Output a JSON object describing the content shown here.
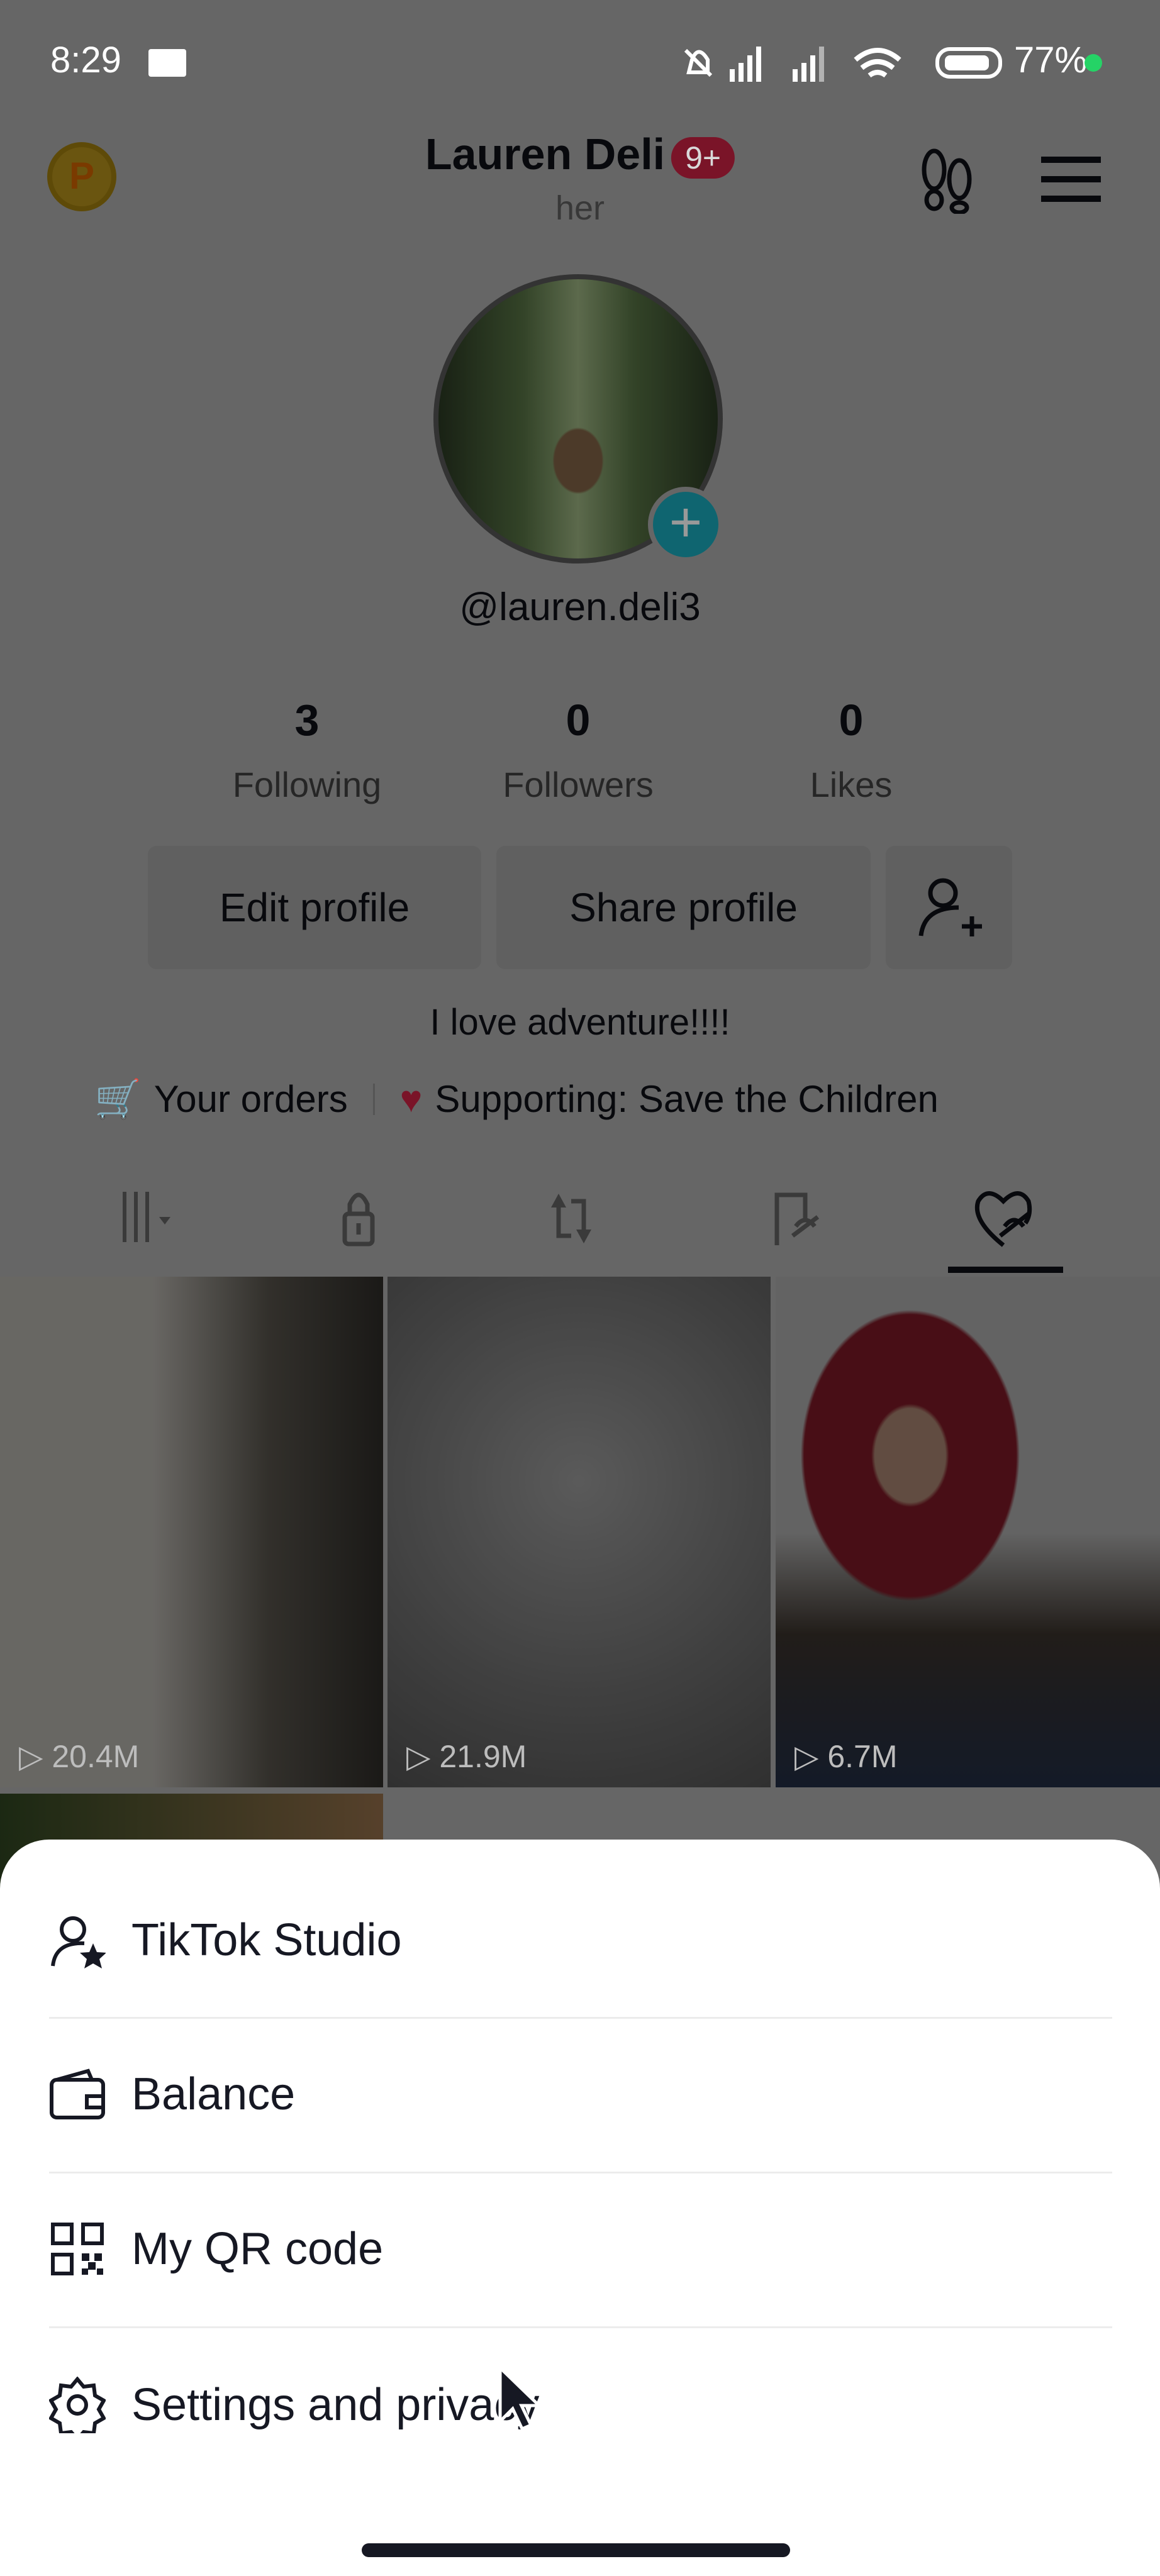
{
  "status_bar": {
    "time": "8:29",
    "battery": "77%",
    "icons": [
      "video-camera-icon",
      "mute-icon",
      "signal-icon",
      "signal-icon",
      "wifi-icon",
      "battery-icon"
    ]
  },
  "header": {
    "coin_label": "P",
    "display_name": "Lauren Deli",
    "notification_badge": "9+",
    "pronouns": "her",
    "icons": [
      "footprints-icon",
      "menu-icon"
    ]
  },
  "profile": {
    "handle": "@lauren.deli3",
    "stats": [
      {
        "value": "3",
        "label": "Following"
      },
      {
        "value": "0",
        "label": "Followers"
      },
      {
        "value": "0",
        "label": "Likes"
      }
    ],
    "edit_label": "Edit profile",
    "share_label": "Share profile",
    "bio": "I love adventure!!!!",
    "orders_label": "Your orders",
    "supporting_label": "Supporting: Save the Children"
  },
  "tabs": [
    {
      "icon": "videos-grid-icon"
    },
    {
      "icon": "lock-icon"
    },
    {
      "icon": "repost-icon"
    },
    {
      "icon": "favorites-hidden-icon"
    },
    {
      "icon": "liked-hidden-icon",
      "active": true
    }
  ],
  "videos": [
    {
      "views": "20.4M"
    },
    {
      "views": "21.9M"
    },
    {
      "views": "6.7M"
    }
  ],
  "menu": {
    "items": [
      {
        "label": "TikTok Studio",
        "icon": "studio-icon"
      },
      {
        "label": "Balance",
        "icon": "wallet-icon"
      },
      {
        "label": "My QR code",
        "icon": "qr-code-icon"
      },
      {
        "label": "Settings and privacy",
        "icon": "gear-icon"
      }
    ]
  },
  "colors": {
    "accent": "#fe2c55",
    "teal": "#20d5ec",
    "overlay": "#666666"
  }
}
